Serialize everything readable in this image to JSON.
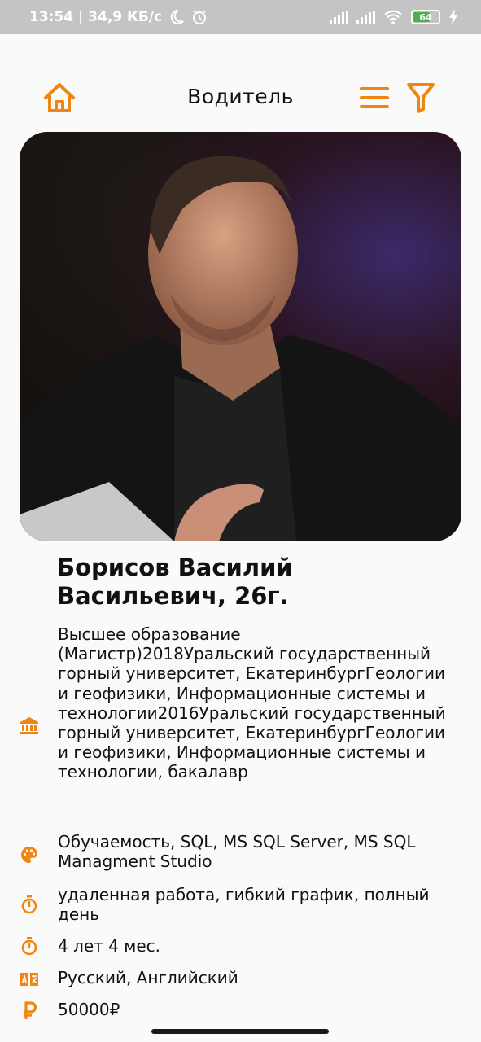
{
  "status_bar": {
    "time_speed": "13:54 | 34,9 КБ/с",
    "battery": "64"
  },
  "app_bar": {
    "title": "Водитель"
  },
  "profile": {
    "name": "Борисов Василий Васильевич, 26г.",
    "photo_alt": "Фото кандидата"
  },
  "details": {
    "education": "Высшее образование (Магистр)2018Уральский государственный горный университет, ЕкатеринбургГеологии и геофизики, Информационные системы и технологии2016Уральский государственный горный университет, ЕкатеринбургГеологии и геофизики, Информационные системы и технологии, бакалавр",
    "skills": "Обучаемость, SQL, MS SQL Server, MS SQL Managment Studio",
    "schedule": "удаленная работа, гибкий график, полный день",
    "experience": "4 лет 4 мес.",
    "languages": "Русский, Английский",
    "salary": "50000₽"
  },
  "colors": {
    "accent": "#f0860f",
    "status_bar_bg": "#c4c4c4",
    "background": "#fafafa"
  },
  "icons": {
    "home": "home-icon",
    "menu": "menu-icon",
    "filter": "filter-icon",
    "education": "bank-icon",
    "skills": "palette-icon",
    "schedule": "stopwatch-icon",
    "experience": "stopwatch-icon",
    "languages": "translate-icon",
    "salary": "ruble-icon"
  }
}
